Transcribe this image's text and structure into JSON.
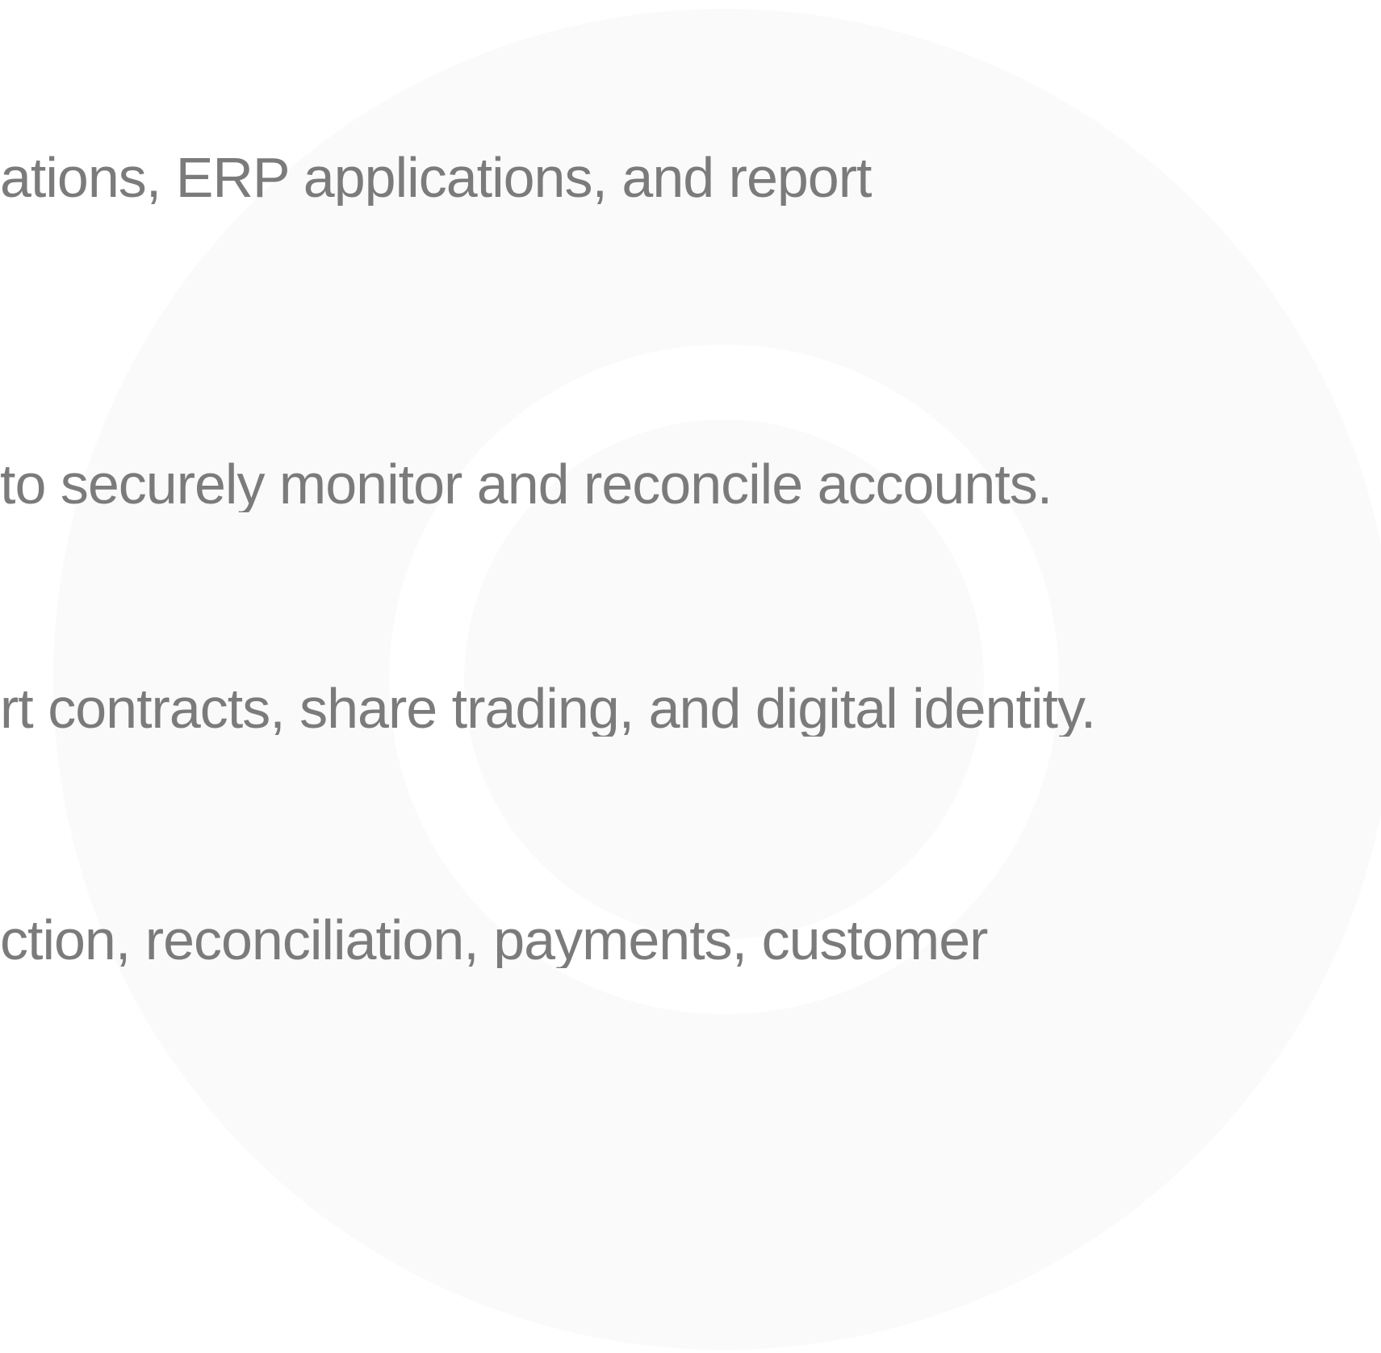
{
  "content": {
    "lines": [
      "ations, ERP applications, and report",
      "to securely monitor and reconcile accounts.",
      "rt contracts, share trading, and digital identity.",
      "ction, reconciliation, payments, customer"
    ]
  },
  "colors": {
    "text": "#7b7b7b",
    "background": "#ffffff",
    "ring": "#fafafa"
  }
}
